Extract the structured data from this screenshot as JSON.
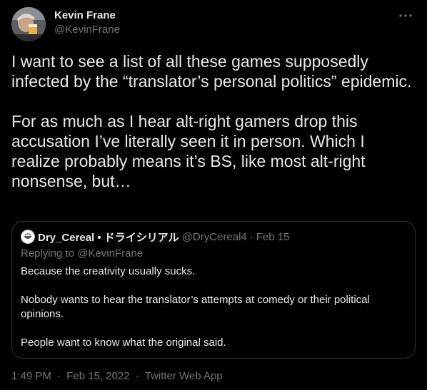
{
  "tweet": {
    "author": {
      "display_name": "Kevin Frane",
      "handle": "@KevinFrane",
      "avatar_icon": "avatar-photo"
    },
    "more_icon": "more-horizontal-icon",
    "paragraphs": [
      "I want to see a list of all these games supposedly infected by the “translator’s personal politics” epidemic.",
      "For as much as I hear alt-right gamers drop this accusation I’ve literally seen it in person. Which I realize probably means it’s BS, like most alt-right nonsense, but…"
    ],
    "quoted": {
      "display_name": "Dry_Cereal • ドライシリアル",
      "handle": "@DryCereal4",
      "separator": "·",
      "date": "Feb 15",
      "replying_prefix": "Replying to",
      "replying_to": "@KevinFrane",
      "paragraphs": [
        "Because the creativity usually sucks.",
        "Nobody wants to hear the translator’s attempts at comedy or their political opinions.",
        "People want to know what the original said."
      ]
    },
    "meta": {
      "time": "1:49 PM",
      "date": "Feb 15, 2022",
      "source": "Twitter Web App",
      "separator": "·"
    }
  },
  "colors": {
    "background": "#000000",
    "text_primary": "#e7e9ea",
    "text_secondary": "#71767b",
    "border": "#2f3336"
  }
}
